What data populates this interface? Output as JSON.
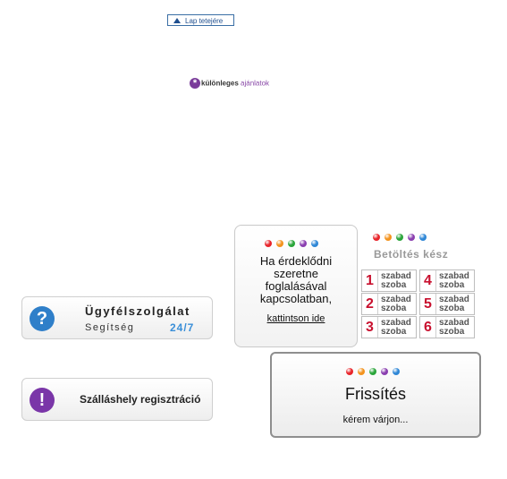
{
  "top_link": {
    "label": "Lap tetejére"
  },
  "offers_logo": {
    "word1": "különleges",
    "word2": "ajánlatok",
    "star": "*"
  },
  "dot_colors": [
    "#e8242a",
    "#f3931e",
    "#2aa53a",
    "#8a3fb0",
    "#2f87d6"
  ],
  "ask_box": {
    "lines": [
      "Ha érdeklődni",
      "szeretne",
      "foglalásával",
      "kapcsolatban,"
    ],
    "link": "kattintson ide"
  },
  "loading": {
    "status": "Betöltés kész"
  },
  "rooms": [
    {
      "number": "1",
      "line1": "szabad",
      "line2": "szoba"
    },
    {
      "number": "4",
      "line1": "szabad",
      "line2": "szoba"
    },
    {
      "number": "2",
      "line1": "szabad",
      "line2": "szoba"
    },
    {
      "number": "5",
      "line1": "szabad",
      "line2": "szoba"
    },
    {
      "number": "3",
      "line1": "szabad",
      "line2": "szoba"
    },
    {
      "number": "6",
      "line1": "szabad",
      "line2": "szoba"
    }
  ],
  "service": {
    "icon": "?",
    "title": "Ügyfélszolgálat",
    "subtitle": "Segítség",
    "hours": "24/7"
  },
  "registration": {
    "icon": "!",
    "label": "Szálláshely regisztráció"
  },
  "refresh": {
    "title": "Frissítés",
    "subtitle": "kérem várjon..."
  }
}
